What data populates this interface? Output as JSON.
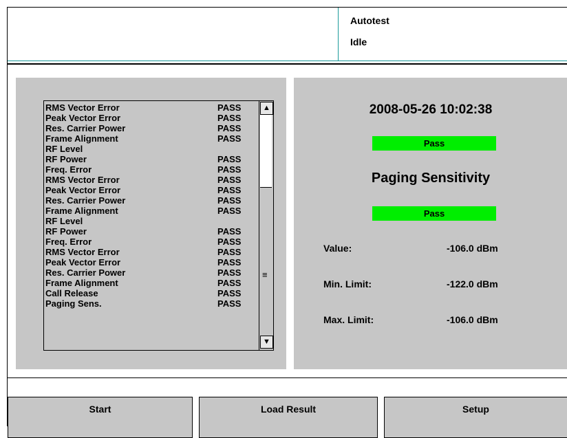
{
  "header": {
    "mode": "Autotest",
    "state": "Idle"
  },
  "results": [
    {
      "name": "RMS Vector Error",
      "result": "PASS"
    },
    {
      "name": "Peak Vector Error",
      "result": "PASS"
    },
    {
      "name": "Res. Carrier Power",
      "result": "PASS"
    },
    {
      "name": "Frame Alignment",
      "result": "PASS"
    },
    {
      "name": "RF Level",
      "result": ""
    },
    {
      "name": "RF Power",
      "result": "PASS"
    },
    {
      "name": "Freq. Error",
      "result": "PASS"
    },
    {
      "name": "RMS Vector Error",
      "result": "PASS"
    },
    {
      "name": "Peak Vector Error",
      "result": "PASS"
    },
    {
      "name": "Res. Carrier Power",
      "result": "PASS"
    },
    {
      "name": "Frame Alignment",
      "result": "PASS"
    },
    {
      "name": "RF Level",
      "result": ""
    },
    {
      "name": "RF Power",
      "result": "PASS"
    },
    {
      "name": "Freq. Error",
      "result": "PASS"
    },
    {
      "name": "RMS Vector Error",
      "result": "PASS"
    },
    {
      "name": "Peak Vector Error",
      "result": "PASS"
    },
    {
      "name": "Res. Carrier Power",
      "result": "PASS"
    },
    {
      "name": "Frame Alignment",
      "result": "PASS"
    },
    {
      "name": "Call Release",
      "result": "PASS"
    },
    {
      "name": "Paging Sens.",
      "result": "PASS"
    }
  ],
  "scroll": {
    "up_icon": "arrow-up-icon",
    "down_icon": "arrow-down-icon",
    "grip_icon": "grip-icon",
    "up_glyph": "▲",
    "down_glyph": "▼",
    "grip_glyph": "≡"
  },
  "detail": {
    "timestamp": "2008-05-26 10:02:38",
    "overall_status": "Pass",
    "test_name": "Paging Sensitivity",
    "test_status": "Pass",
    "value_label": "Value:",
    "value": "-106.0 dBm",
    "min_label": "Min. Limit:",
    "min_value": "-122.0 dBm",
    "max_label": "Max. Limit:",
    "max_value": "-106.0 dBm"
  },
  "softkeys": {
    "start": "Start",
    "load_result": "Load Result",
    "setup": "Setup"
  },
  "colors": {
    "panel": "#c6c6c6",
    "pass_green": "#00ee00",
    "header_line": "#1a9a9a"
  }
}
